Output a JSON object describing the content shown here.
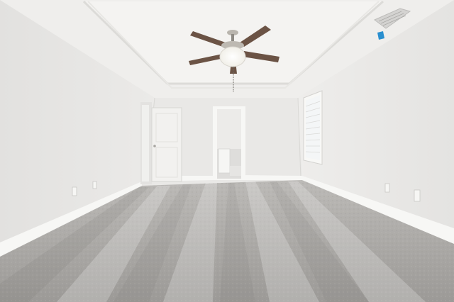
{
  "scene": {
    "description_name": "empty-carpeted-bedroom",
    "colors": {
      "ceiling": "#efeeec",
      "tray_ceiling": "#f3f2f0",
      "left_wall": "#e6e5e3",
      "back_wall": "#e9e8e6",
      "right_wall": "#eae9e7",
      "baseboard": "#f7f7f5",
      "carpet": "#a9a7a4",
      "carpet_dark": "#8f8d8a",
      "door": "#f2f1ef",
      "doorway_inside": "#dcdcda",
      "window_glass": "#f4f6f7",
      "fan_blade": "#6b5345",
      "fan_light": "#fbfaf5",
      "fan_body": "#b9b5ae",
      "vent": "#cfcfcd",
      "sensor_tag": "#2a8fcf"
    }
  }
}
